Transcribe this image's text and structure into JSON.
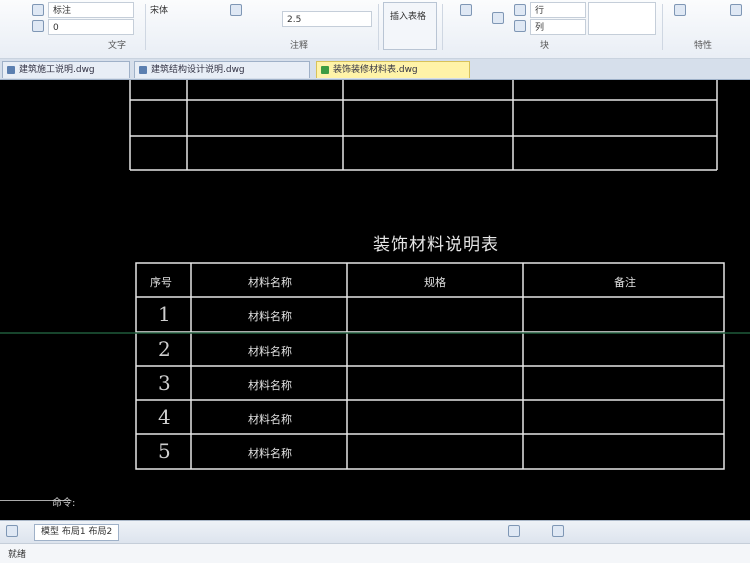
{
  "ribbon": {
    "groups": [
      {
        "label": "文字"
      },
      {
        "label": "注释"
      },
      {
        "label": "块"
      },
      {
        "label": "特性"
      }
    ],
    "style_field": "标注",
    "layer_field": "0",
    "font_field": "宋体",
    "size_field": "2.5",
    "row_field": "行",
    "col_field": "列",
    "big_button_label": "插入表格"
  },
  "tabs": [
    {
      "label": "建筑施工说明.dwg"
    },
    {
      "label": "建筑结构设计说明.dwg"
    },
    {
      "label": "装饰装修材料表.dwg"
    }
  ],
  "canvas": {
    "table_title": "装饰材料说明表",
    "headers": [
      "序号",
      "材料名称",
      "规格",
      "备注"
    ],
    "rows": [
      {
        "num": "1",
        "name": "材料名称"
      },
      {
        "num": "2",
        "name": "材料名称"
      },
      {
        "num": "3",
        "name": "材料名称"
      },
      {
        "num": "4",
        "name": "材料名称"
      },
      {
        "num": "5",
        "name": "材料名称"
      }
    ],
    "command_prompt": "命令:"
  },
  "statusbar": {
    "tab_label": "模型 布局1 布局2"
  },
  "bottombar": {
    "text": "就绪"
  },
  "colors": {
    "canvas_bg": "#000000",
    "table_line": "#e8e8e8",
    "active_tab": "#fff3a8"
  }
}
